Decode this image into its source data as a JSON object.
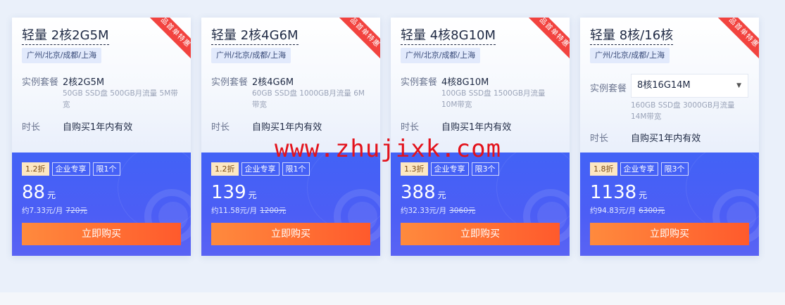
{
  "cards": [
    {
      "ribbon": "产品首单特惠",
      "title": "轻量 2核2G5M",
      "region": "广州/北京/成都/上海",
      "spec_label": "实例套餐",
      "spec_value": "2核2G5M",
      "spec_desc": "50GB SSD盘 500GB月流量 5M带宽",
      "duration_label": "时长",
      "duration_value": "自购买1年内有效",
      "discount": "1.2折",
      "tag_enterprise": "企业专享",
      "tag_limit": "限1个",
      "price": "88",
      "price_unit": "元",
      "monthly": "约7.33元/月",
      "original": "720元",
      "buy_label": "立即购买"
    },
    {
      "ribbon": "产品首单特惠",
      "title": "轻量 2核4G6M",
      "region": "广州/北京/成都/上海",
      "spec_label": "实例套餐",
      "spec_value": "2核4G6M",
      "spec_desc": "60GB SSD盘 1000GB月流量 6M带宽",
      "duration_label": "时长",
      "duration_value": "自购买1年内有效",
      "discount": "1.2折",
      "tag_enterprise": "企业专享",
      "tag_limit": "限1个",
      "price": "139",
      "price_unit": "元",
      "monthly": "约11.58元/月",
      "original": "1200元",
      "buy_label": "立即购买"
    },
    {
      "ribbon": "产品首单特惠",
      "title": "轻量 4核8G10M",
      "region": "广州/北京/成都/上海",
      "spec_label": "实例套餐",
      "spec_value": "4核8G10M",
      "spec_desc": "100GB SSD盘 1500GB月流量 10M带宽",
      "duration_label": "时长",
      "duration_value": "自购买1年内有效",
      "discount": "1.3折",
      "tag_enterprise": "企业专享",
      "tag_limit": "限3个",
      "price": "388",
      "price_unit": "元",
      "monthly": "约32.33元/月",
      "original": "3060元",
      "buy_label": "立即购买"
    },
    {
      "ribbon": "产品首单特惠",
      "title": "轻量 8核/16核",
      "region": "广州/北京/成都/上海",
      "spec_label": "实例套餐",
      "spec_value": "8核16G14M",
      "spec_desc": "160GB SSD盘 3000GB月流量 14M带宽",
      "duration_label": "时长",
      "duration_value": "自购买1年内有效",
      "discount": "1.8折",
      "tag_enterprise": "企业专享",
      "tag_limit": "限3个",
      "price": "1138",
      "price_unit": "元",
      "monthly": "约94.83元/月",
      "original": "6300元",
      "buy_label": "立即购买"
    }
  ],
  "watermark": "www.zhujixk.com",
  "colors": {
    "accent_blue": "#4262f6",
    "buy_orange": "#ff6a2f",
    "ribbon_red": "#f2433f",
    "watermark_red": "#e3121b"
  }
}
